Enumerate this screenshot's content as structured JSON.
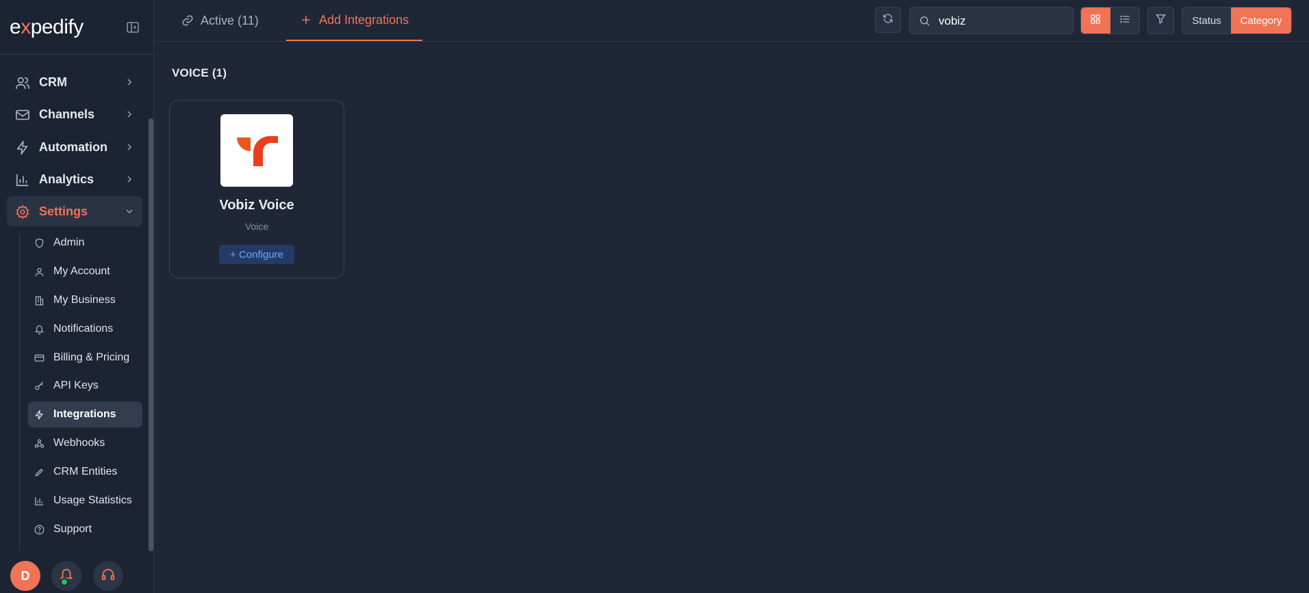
{
  "brand": {
    "logo_prefix": "e",
    "logo_x": "x",
    "logo_suffix": "pedify"
  },
  "sidebar": {
    "items": [
      {
        "label": "CRM",
        "icon": "users-icon"
      },
      {
        "label": "Channels",
        "icon": "mail-icon"
      },
      {
        "label": "Automation",
        "icon": "bolt-icon"
      },
      {
        "label": "Analytics",
        "icon": "bar-chart-icon"
      },
      {
        "label": "Settings",
        "icon": "gear-icon"
      }
    ],
    "settings_items": [
      {
        "label": "Admin",
        "icon": "shield-icon"
      },
      {
        "label": "My Account",
        "icon": "user-icon"
      },
      {
        "label": "My Business",
        "icon": "building-icon"
      },
      {
        "label": "Notifications",
        "icon": "bell-icon"
      },
      {
        "label": "Billing & Pricing",
        "icon": "credit-card-icon"
      },
      {
        "label": "API Keys",
        "icon": "key-icon"
      },
      {
        "label": "Integrations",
        "icon": "bolt-icon"
      },
      {
        "label": "Webhooks",
        "icon": "webhook-icon"
      },
      {
        "label": "CRM Entities",
        "icon": "pencil-icon"
      },
      {
        "label": "Usage Statistics",
        "icon": "bar-chart-icon"
      },
      {
        "label": "Support",
        "icon": "help-circle-icon"
      }
    ],
    "avatar_initial": "D"
  },
  "tabs": {
    "active_label": "Active (11)",
    "add_label": "Add Integrations"
  },
  "search": {
    "value": "vobiz"
  },
  "group_by": {
    "status": "Status",
    "category": "Category"
  },
  "main": {
    "section_title": "VOICE (1)",
    "cards": [
      {
        "name": "Vobiz Voice",
        "category": "Voice",
        "action": "+ Configure"
      }
    ]
  },
  "colors": {
    "accent": "#f07356",
    "bg": "#1f2736",
    "sidebar": "#1c2433",
    "link": "#6aa8ff"
  }
}
